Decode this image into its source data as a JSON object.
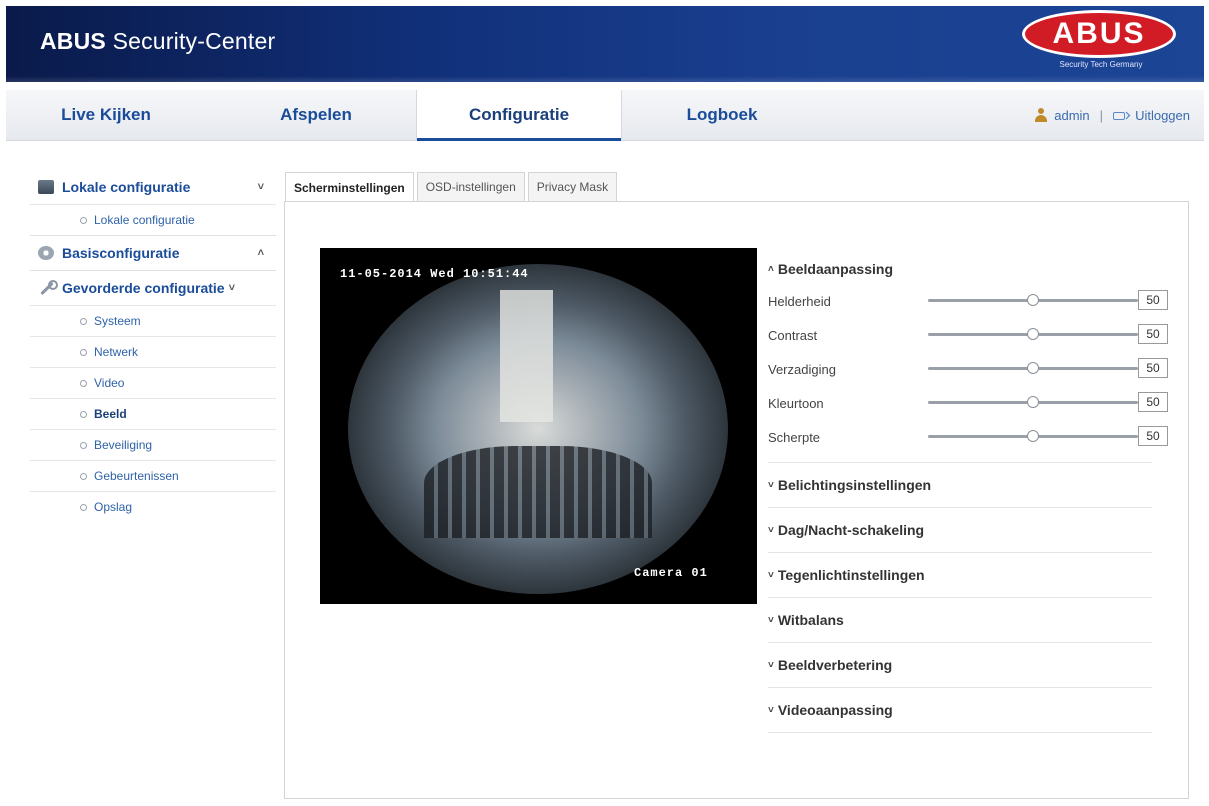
{
  "header": {
    "brand_bold": "ABUS",
    "brand_rest": " Security-Center",
    "logo_text": "ABUS",
    "logo_sub": "Security Tech Germany"
  },
  "nav": {
    "tabs": [
      {
        "label": "Live Kijken"
      },
      {
        "label": "Afspelen"
      },
      {
        "label": "Configuratie"
      },
      {
        "label": "Logboek"
      }
    ],
    "active_tab": "Configuratie",
    "user": "admin",
    "separator": "|",
    "logout": "Uitloggen"
  },
  "sidebar": {
    "local": {
      "label": "Lokale configuratie",
      "chevron": "˅",
      "items": [
        {
          "label": "Lokale configuratie"
        }
      ]
    },
    "basic": {
      "label": "Basisconfiguratie",
      "chevron": "˄"
    },
    "advanced": {
      "label": "Gevorderde configuratie",
      "chevron": "˅",
      "items": [
        {
          "label": "Systeem"
        },
        {
          "label": "Netwerk"
        },
        {
          "label": "Video"
        },
        {
          "label": "Beeld"
        },
        {
          "label": "Beveiliging"
        },
        {
          "label": "Gebeurtenissen"
        },
        {
          "label": "Opslag"
        }
      ],
      "active_item": "Beeld"
    }
  },
  "tabs": [
    {
      "label": "Scherminstellingen"
    },
    {
      "label": "OSD-instellingen"
    },
    {
      "label": "Privacy Mask"
    }
  ],
  "active_tab": "Scherminstellingen",
  "video": {
    "osd_datetime": "11-05-2014 Wed 10:51:44",
    "osd_camera": "Camera 01"
  },
  "settings": {
    "image_adjust": {
      "label": "Beeldaanpassing",
      "expanded": true,
      "rows": [
        {
          "label": "Helderheid",
          "value": "50"
        },
        {
          "label": "Contrast",
          "value": "50"
        },
        {
          "label": "Verzadiging",
          "value": "50"
        },
        {
          "label": "Kleurtoon",
          "value": "50"
        },
        {
          "label": "Scherpte",
          "value": "50"
        }
      ],
      "slider_max": 100
    },
    "sections": [
      {
        "label": "Belichtingsinstellingen"
      },
      {
        "label": "Dag/Nacht-schakeling"
      },
      {
        "label": "Tegenlichtinstellingen"
      },
      {
        "label": "Witbalans"
      },
      {
        "label": "Beeldverbetering"
      },
      {
        "label": "Videoaanpassing"
      }
    ],
    "arrow_open": "˄",
    "arrow_closed": "˅"
  },
  "colors": {
    "header_dark": "#0a1a4a",
    "link_blue": "#1a4c9a",
    "logo_red": "#d21c25"
  }
}
